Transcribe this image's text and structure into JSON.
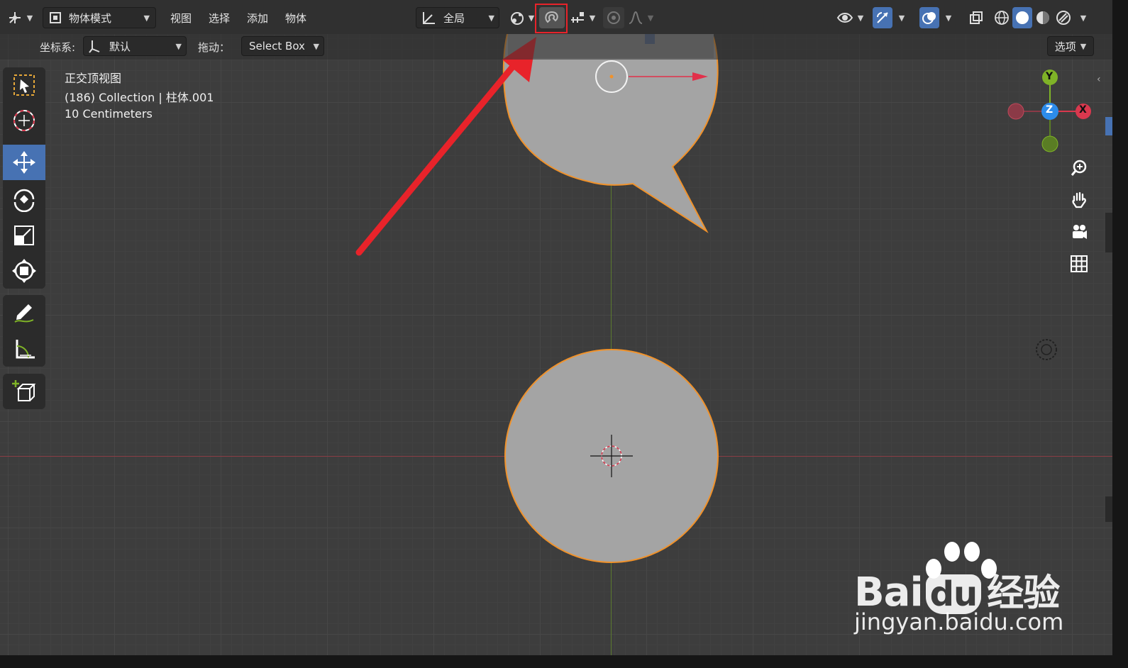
{
  "header": {
    "mode_label": "物体模式",
    "menus": [
      "视图",
      "选择",
      "添加",
      "物体"
    ],
    "transform_orientation": "全局",
    "options_label": "选项"
  },
  "tool_settings": {
    "coord_label": "坐标系:",
    "coord_value": "默认",
    "drag_label": "拖动：",
    "drag_value": "Select Box"
  },
  "viewport_info": {
    "view_name": "正交顶视图",
    "collection": "(186) Collection | 柱体.001",
    "scale": "10 Centimeters"
  },
  "gizmo": {
    "y_label": "Y",
    "z_label": "Z",
    "x_label": "X",
    "colors": {
      "x": "#d9384e",
      "y": "#7fb327",
      "z": "#2d8ceb"
    }
  },
  "annotation": {
    "arrow_color": "#e8232a",
    "highlight": "snap-button"
  },
  "watermark": {
    "brand": "Bai",
    "brand2": "du",
    "cn": "经验",
    "url": "jingyan.baidu.com"
  },
  "colors": {
    "accent": "#4772b3",
    "selection_outline": "#f0922b",
    "mesh": "#a4a4a4"
  }
}
